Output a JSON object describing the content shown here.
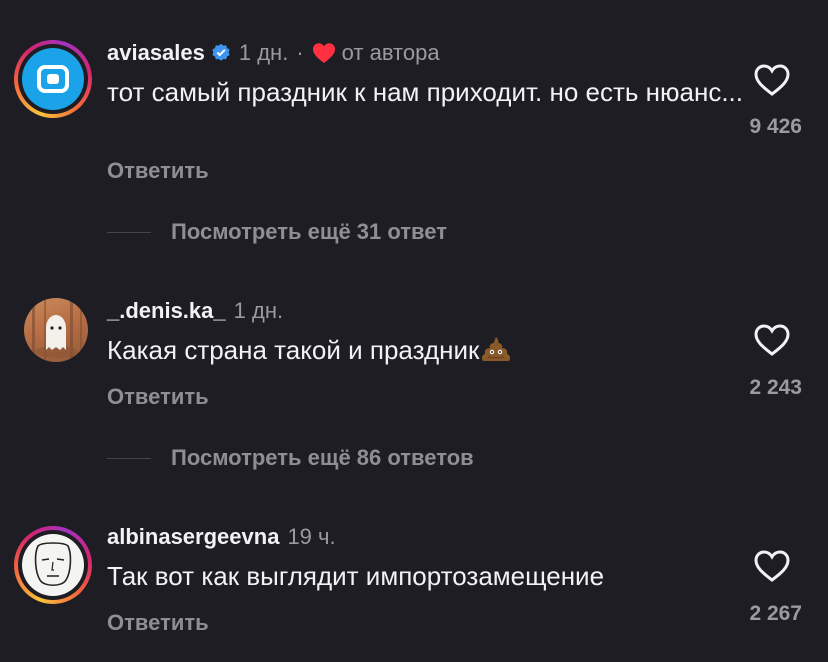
{
  "comments": [
    {
      "username": "aviasales",
      "verified": true,
      "time": "1 дн.",
      "separator": "·",
      "author_badge": "от автора",
      "text": "тот самый праздник к нам приходит. но есть нюанс...",
      "reply_label": "Ответить",
      "likes": "9 426",
      "view_more": "Посмотреть ещё 31 ответ",
      "avatar_icon": "aviasales-logo-icon"
    },
    {
      "username": "_.denis.ka_",
      "time": "1 дн.",
      "text": "Какая страна такой и праздник",
      "text_emoji": "pile-of-poo-emoji",
      "reply_label": "Ответить",
      "likes": "2 243",
      "view_more": "Посмотреть ещё 86 ответов",
      "avatar_icon": "ghost-forest-illustration"
    },
    {
      "username": "albinasergeevna",
      "time": "19 ч.",
      "text": "Так вот как выглядит импортозамещение",
      "reply_label": "Ответить",
      "likes": "2 267",
      "avatar_icon": "face-sketch-illustration"
    }
  ],
  "colors": {
    "background": "#1d1d23",
    "text_primary": "#f2f2f5",
    "text_secondary": "#9a9aa3",
    "verified_blue": "#3d95f0",
    "author_heart": "#ff3040"
  }
}
